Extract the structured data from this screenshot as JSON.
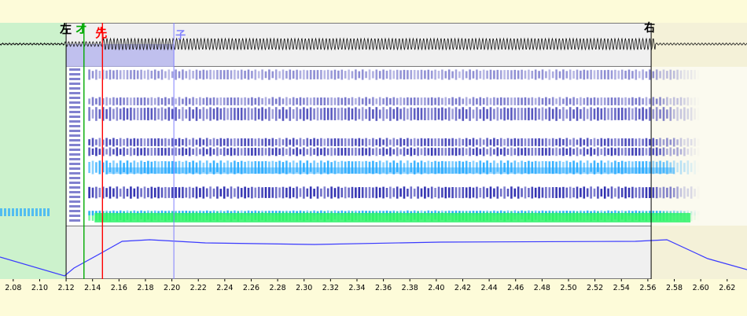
{
  "markers": {
    "left": {
      "label": "左",
      "time": 2.12,
      "color": "#000000"
    },
    "offset": {
      "label": "オ",
      "time": 2.1335,
      "color": "#00aa00"
    },
    "preutter": {
      "label": "先",
      "time": 2.1475,
      "color": "#ff0000"
    },
    "consonant": {
      "label": "子",
      "time": 2.2015,
      "color": "#8080ff"
    },
    "right": {
      "label": "右",
      "time": 2.5625,
      "color": "#000000"
    }
  },
  "time_axis": {
    "start": 2.07,
    "end": 2.635,
    "ticks": [
      "2.08",
      "2.10",
      "2.12",
      "2.14",
      "2.16",
      "2.18",
      "2.20",
      "2.22",
      "2.24",
      "2.26",
      "2.28",
      "2.30",
      "2.32",
      "2.34",
      "2.36",
      "2.38",
      "2.40",
      "2.42",
      "2.44",
      "2.46",
      "2.48",
      "2.50",
      "2.52",
      "2.54",
      "2.56",
      "2.58",
      "2.60",
      "2.62"
    ]
  },
  "colors": {
    "background": "#fdfbd9",
    "panel": "#f0f0f0",
    "left_region": "#ccf2cc",
    "right_region": "#f4f1d8",
    "consonant_region": "#b0b0ee",
    "envelope_line": "#3a3aff",
    "spectro_low": "#1a1aa8",
    "spectro_mid": "#1fa7ff",
    "spectro_high": "#2ef36a"
  }
}
